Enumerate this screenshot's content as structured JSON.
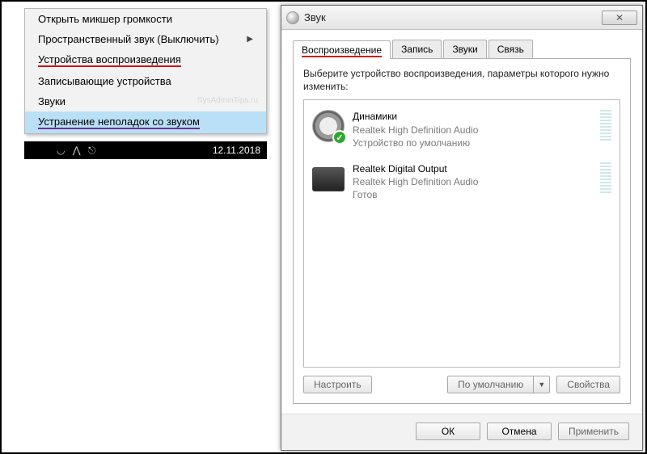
{
  "context_menu": {
    "items": [
      {
        "label": "Открыть микшер громкости",
        "has_submenu": false
      },
      {
        "label": "Пространственный звук (Выключить)",
        "has_submenu": true
      },
      {
        "label": "Устройства воспроизведения",
        "has_submenu": false,
        "underline": "red"
      },
      {
        "label": "Записывающие устройства",
        "has_submenu": false
      },
      {
        "label": "Звуки",
        "has_submenu": false
      },
      {
        "label": "Устранение неполадок со звуком",
        "has_submenu": false,
        "highlighted": true,
        "underline": "purple"
      }
    ],
    "watermark": "SysAdminTips.ru"
  },
  "taskbar": {
    "date": "12.11.2018"
  },
  "sound_dialog": {
    "title": "Звук",
    "close_glyph": "✕",
    "tabs": [
      {
        "label": "Воспроизведение",
        "active": true
      },
      {
        "label": "Запись",
        "active": false
      },
      {
        "label": "Звуки",
        "active": false
      },
      {
        "label": "Связь",
        "active": false
      }
    ],
    "instruction": "Выберите устройство воспроизведения, параметры которого нужно изменить:",
    "devices": [
      {
        "name": "Динамики",
        "driver": "Realtek High Definition Audio",
        "status": "Устройство по умолчанию",
        "icon": "speaker",
        "default": true
      },
      {
        "name": "Realtek Digital Output",
        "driver": "Realtek High Definition Audio",
        "status": "Готов",
        "icon": "hardware",
        "default": false
      }
    ],
    "buttons": {
      "configure": "Настроить",
      "set_default": "По умолчанию",
      "properties": "Свойства",
      "ok": "ОК",
      "cancel": "Отмена",
      "apply": "Применить"
    }
  }
}
